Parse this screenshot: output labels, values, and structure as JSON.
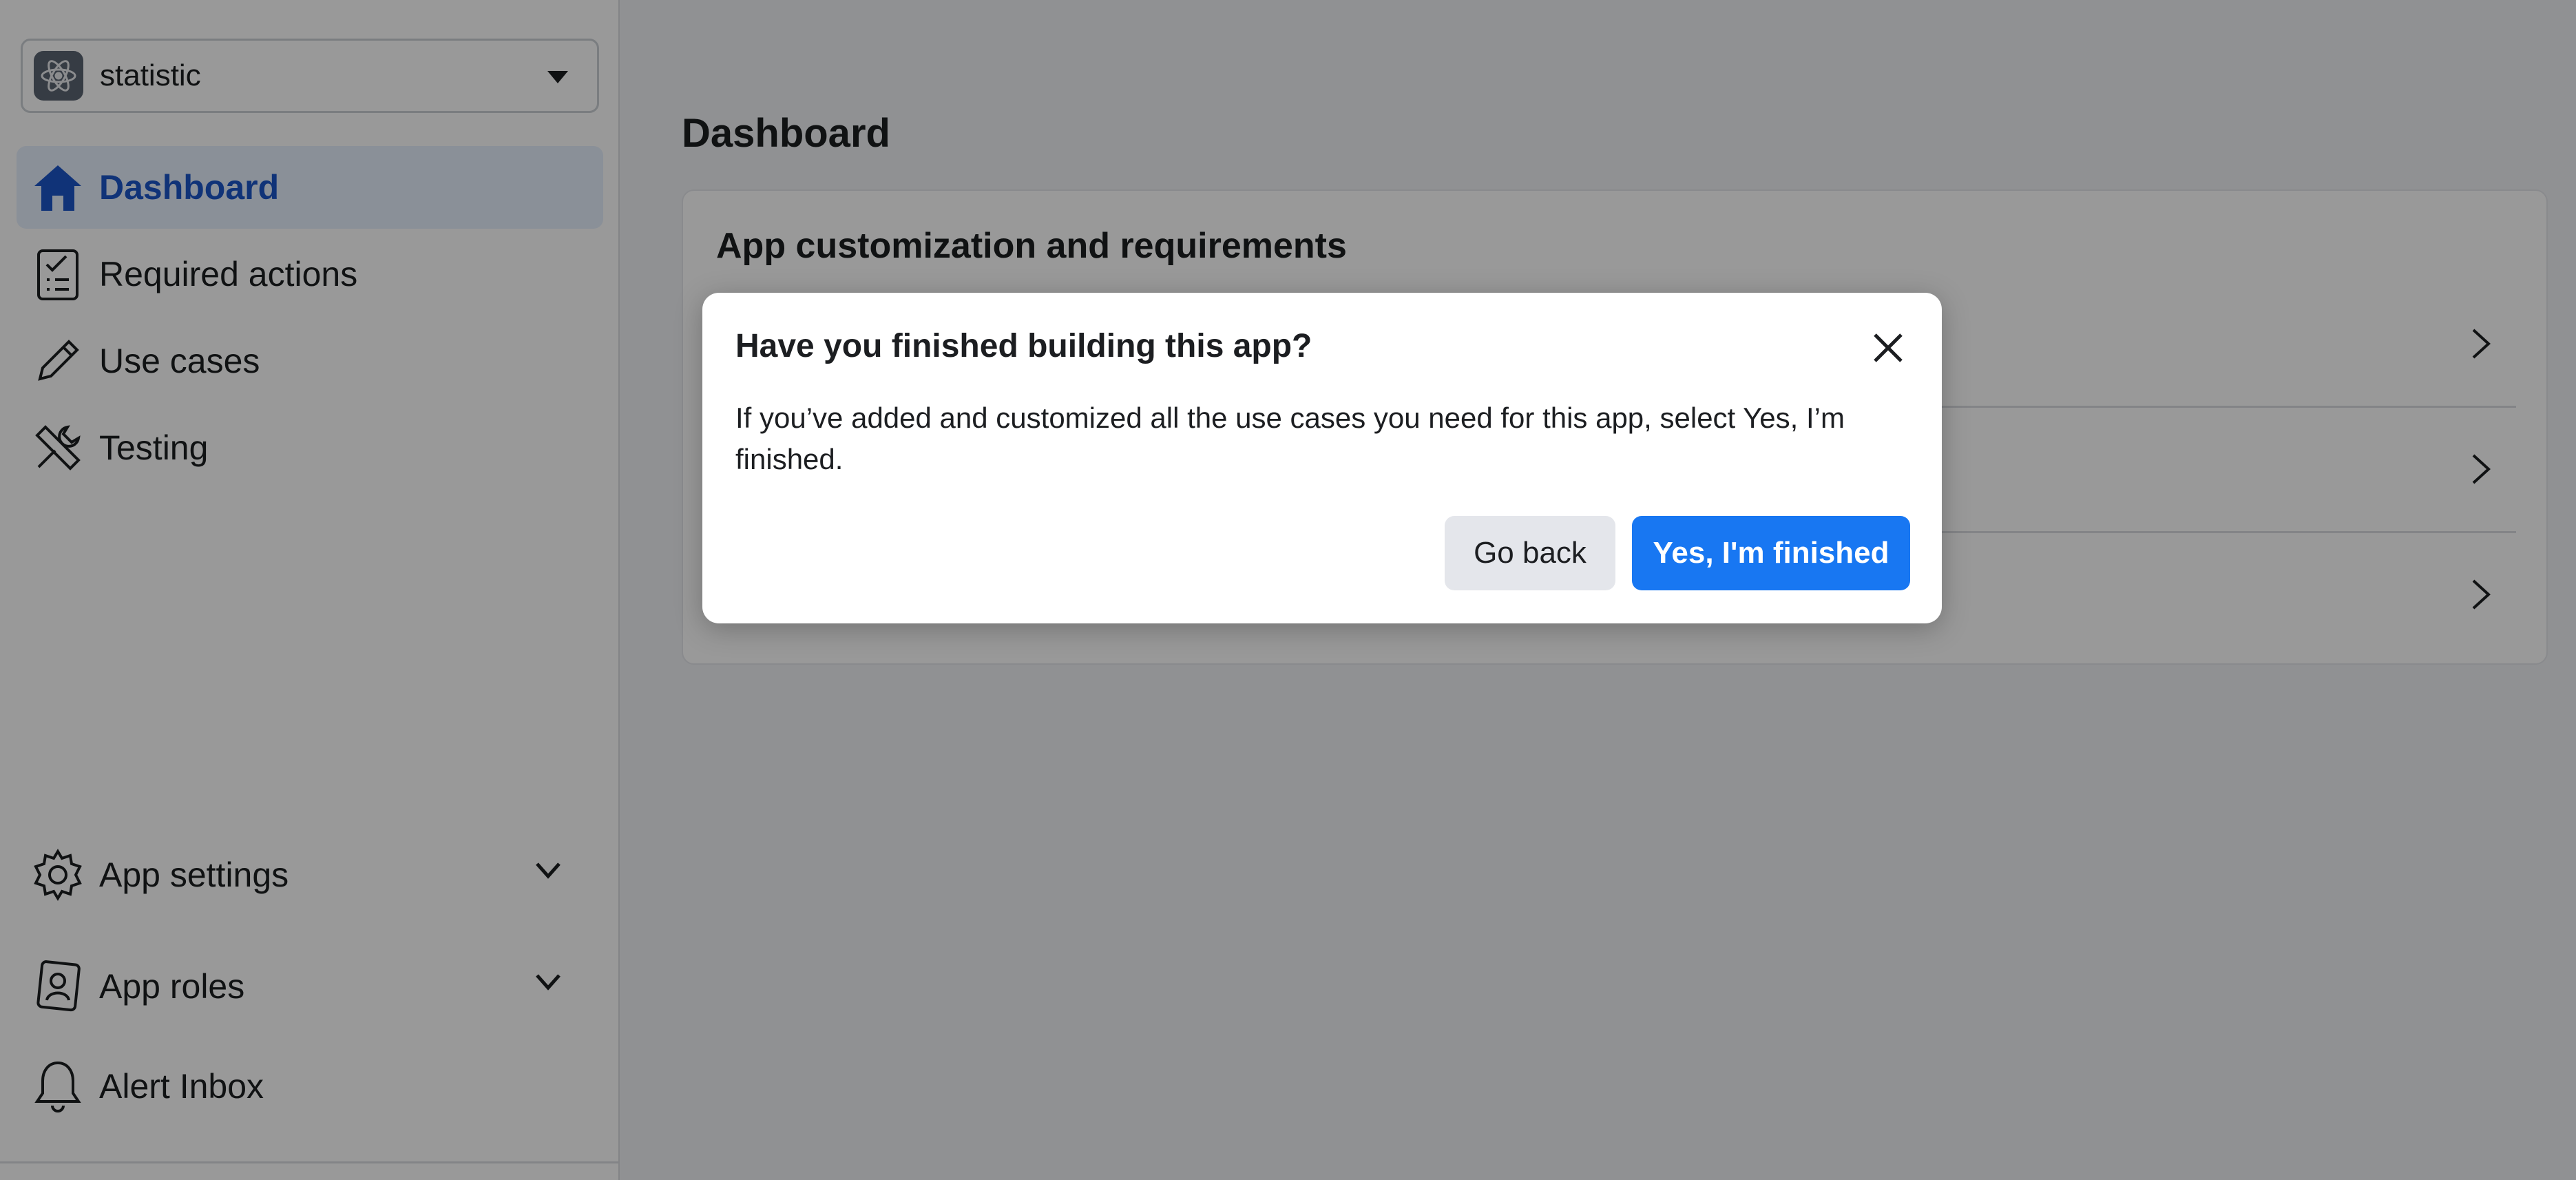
{
  "app_selector": {
    "name": "statistic"
  },
  "sidebar": {
    "items": [
      {
        "label": "Dashboard",
        "icon": "home-icon",
        "active": true
      },
      {
        "label": "Required actions",
        "icon": "checklist-icon"
      },
      {
        "label": "Use cases",
        "icon": "pencil-icon"
      },
      {
        "label": "Testing",
        "icon": "tools-icon"
      }
    ],
    "bottom_items": [
      {
        "label": "App settings",
        "icon": "gear-icon",
        "expandable": true
      },
      {
        "label": "App roles",
        "icon": "badge-icon",
        "expandable": true
      },
      {
        "label": "Alert Inbox",
        "icon": "bell-icon"
      }
    ]
  },
  "main": {
    "title": "Dashboard",
    "card": {
      "title": "App customization and requirements"
    }
  },
  "dialog": {
    "title": "Have you finished building this app?",
    "body": "If you’ve added and customized all the use cases you need for this app, select Yes, I’m finished.",
    "secondary_label": "Go back",
    "primary_label": "Yes, I'm finished"
  },
  "colors": {
    "accent": "#1877f2",
    "active_nav_bg": "#e7f0fd",
    "active_nav_text": "#1b55c9"
  }
}
